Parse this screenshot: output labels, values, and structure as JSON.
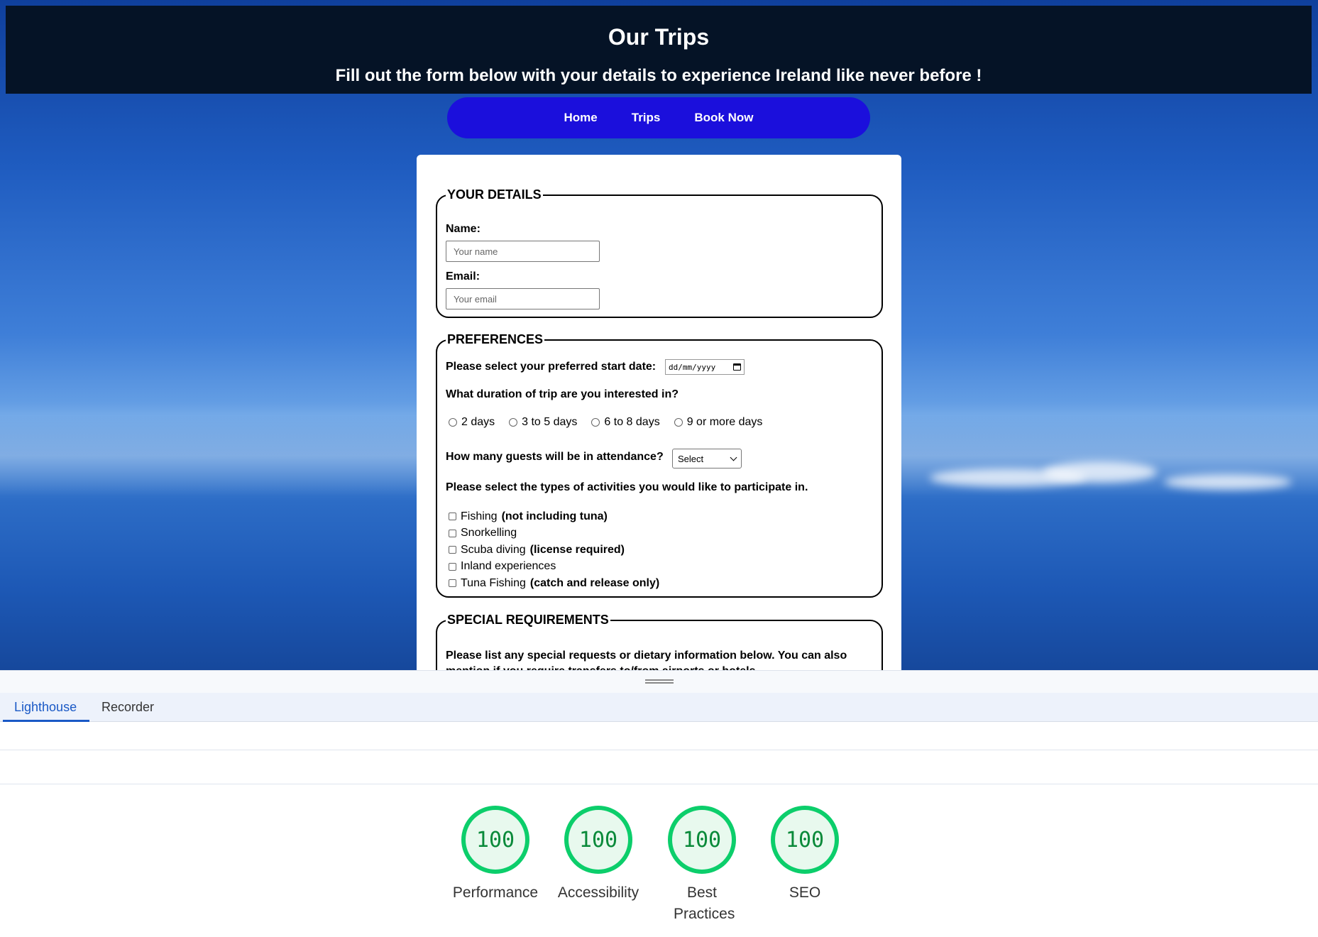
{
  "hero": {
    "title": "Our Trips",
    "subtitle": "Fill out the form below with your details to experience Ireland like never before !"
  },
  "nav": {
    "items": [
      "Home",
      "Trips",
      "Book Now"
    ]
  },
  "details": {
    "legend": "YOUR DETAILS",
    "name_label": "Name:",
    "name_placeholder": "Your name",
    "email_label": "Email:",
    "email_placeholder": "Your email"
  },
  "preferences": {
    "legend": "PREFERENCES",
    "date_label": "Please select your preferred start date:",
    "date_placeholder": "dd/mm/yyyy",
    "duration_label": "What duration of trip are you interested in?",
    "durations": [
      "2 days",
      "3 to 5 days",
      "6 to 8 days",
      "9 or more days"
    ],
    "guests_label": "How many guests will be in attendance?",
    "guests_selected": "Select",
    "activities_label": "Please select the types of activities you would like to participate in.",
    "activities": [
      {
        "label": "Fishing",
        "note": "(not including tuna)"
      },
      {
        "label": "Snorkelling",
        "note": ""
      },
      {
        "label": "Scuba diving",
        "note": "(license required)"
      },
      {
        "label": "Inland experiences",
        "note": ""
      },
      {
        "label": "Tuna Fishing",
        "note": "(catch and release only)"
      }
    ]
  },
  "special": {
    "legend": "SPECIAL REQUIREMENTS",
    "text": "Please list any special requests or dietary information below. You can also mention if you require transfers to/from airports or hotels."
  },
  "devtools": {
    "tabs": [
      "Lighthouse",
      "Recorder"
    ],
    "active_tab": "Lighthouse",
    "scores": [
      {
        "label": "Performance",
        "value": "100"
      },
      {
        "label": "Accessibility",
        "value": "100"
      },
      {
        "label": "Best Practices",
        "value": "100"
      },
      {
        "label": "SEO",
        "value": "100"
      }
    ],
    "score_color": "#0cce6b"
  }
}
